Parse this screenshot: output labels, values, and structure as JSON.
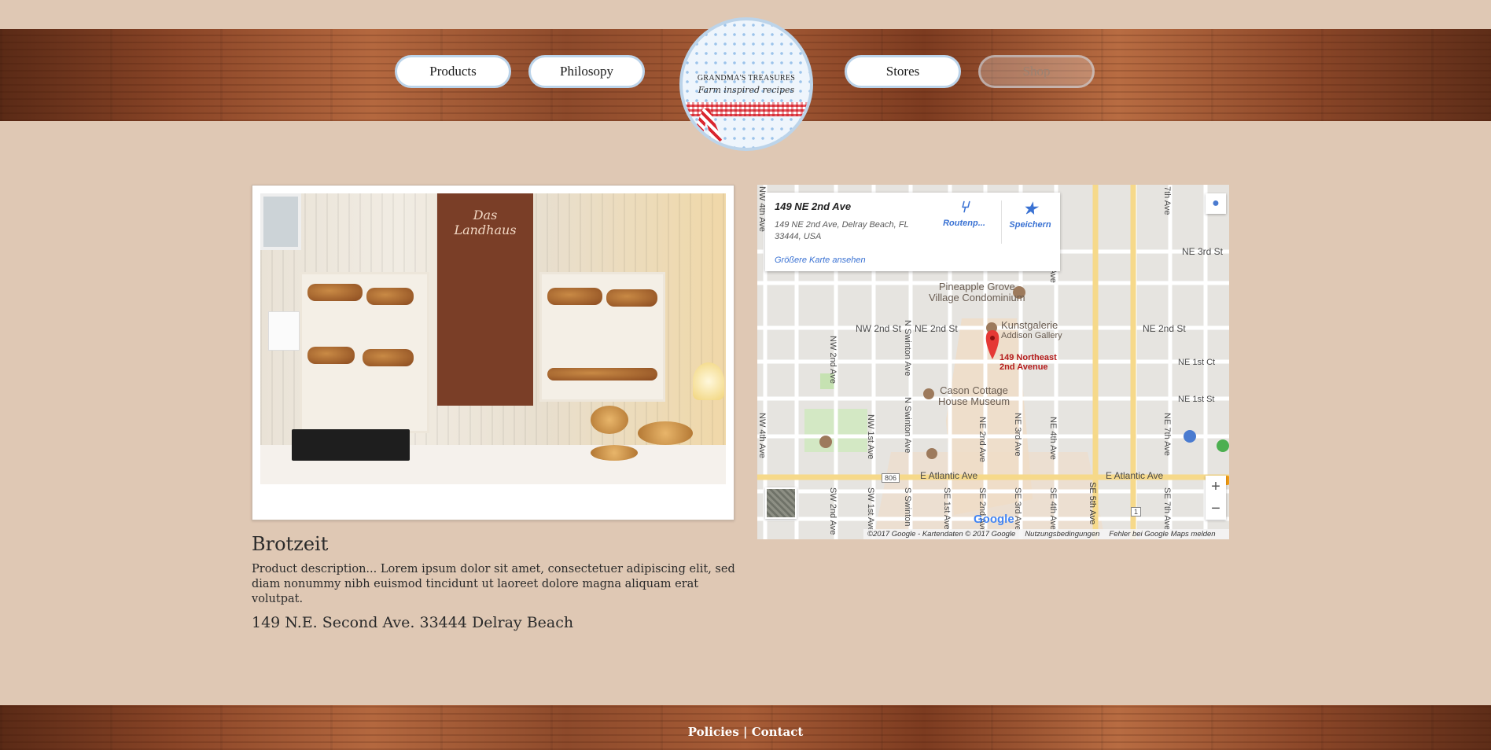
{
  "nav": {
    "products": "Products",
    "philosophy": "Philosopy",
    "stores": "Stores",
    "shop": "Shop"
  },
  "logo": {
    "title": "GRANDMA'S TREASURES",
    "subtitle": "Farm inspired recipes"
  },
  "product": {
    "title": "Brotzeit",
    "description": "Product description... Lorem ipsum dolor sit amet, consectetuer adipiscing elit, sed diam nonummy nibh euismod tincidunt ut laoreet dolore magna aliquam erat volutpat.",
    "address": "149 N.E. Second Ave. 33444 Delray Beach",
    "photo_board_text": "Das Landhaus"
  },
  "map": {
    "info_title": "149 NE 2nd Ave",
    "info_address": "149 NE 2nd Ave, Delray Beach, FL 33444, USA",
    "directions": "Routenp...",
    "save": "Speichern",
    "larger_map": "Größere Karte ansehen",
    "labels": {
      "pineapple": "Pineapple Grove\nVillage Condominium",
      "kunst": "Kunstgalerie",
      "addison": "Addison Gallery",
      "marker": "149 Northeast\n2nd Avenue",
      "cason": "Cason Cottage\nHouse Museum",
      "nw2nd_st": "NW 2nd St",
      "ne2nd_st_a": "NE 2nd St",
      "ne2nd_st_b": "NE 2nd St",
      "ne3rd_st": "NE 3rd St",
      "ne1st_ct": "NE 1st Ct",
      "ne1st_st": "NE 1st St",
      "e_atlantic_a": "E Atlantic Ave",
      "e_atlantic_b": "E Atlantic Ave",
      "nw4th_ave_a": "NW 4th Ave",
      "nw2nd_ave": "NW 2nd Ave",
      "nw1st_ave": "NW 1st Ave",
      "n_swinton_a": "N Swinton Ave",
      "n_swinton_b": "N Swinton Ave",
      "ne2nd_ave": "NE 2nd Ave",
      "ne3rd_ave": "NE 3rd Ave",
      "ne4th_ave_a": "NE 4th Ave",
      "ne4th_ave_b": "NE 4th Ave",
      "se5th_ave": "SE 5th Ave",
      "ne7th_ave": "NE 7th Ave",
      "seventh_ave": "7th Ave",
      "sw2nd_ave": "SW 2nd Ave",
      "sw1st_ave": "SW 1st Ave",
      "s_swinton": "S Swinton",
      "se1st_ave": "SE 1st Ave",
      "se2nd_ave": "SE 2nd Ave",
      "se3rd_ave": "SE 3rd Ave",
      "se4th_ave": "SE 4th Ave",
      "se7th_ave": "SE 7th Ave",
      "nw4th_ave_b": "NW 4th Ave",
      "route806": "806",
      "route1": "1"
    },
    "google": "Google",
    "attribution": {
      "copyright": "©2017 Google - Kartendaten © 2017 Google",
      "terms": "Nutzungsbedingungen",
      "report": "Fehler bei Google Maps melden"
    },
    "zoom_in": "+",
    "zoom_out": "−"
  },
  "footer": {
    "policies": "Policies",
    "separator": "|",
    "contact": "Contact"
  },
  "colors": {
    "background": "#dfc8b4",
    "pill_border": "#bcd4ea",
    "map_link": "#3a72d3",
    "marker": "#e53935"
  },
  "icons": [
    "directions-icon",
    "star-icon",
    "pegman-icon",
    "map-pin-icon"
  ]
}
